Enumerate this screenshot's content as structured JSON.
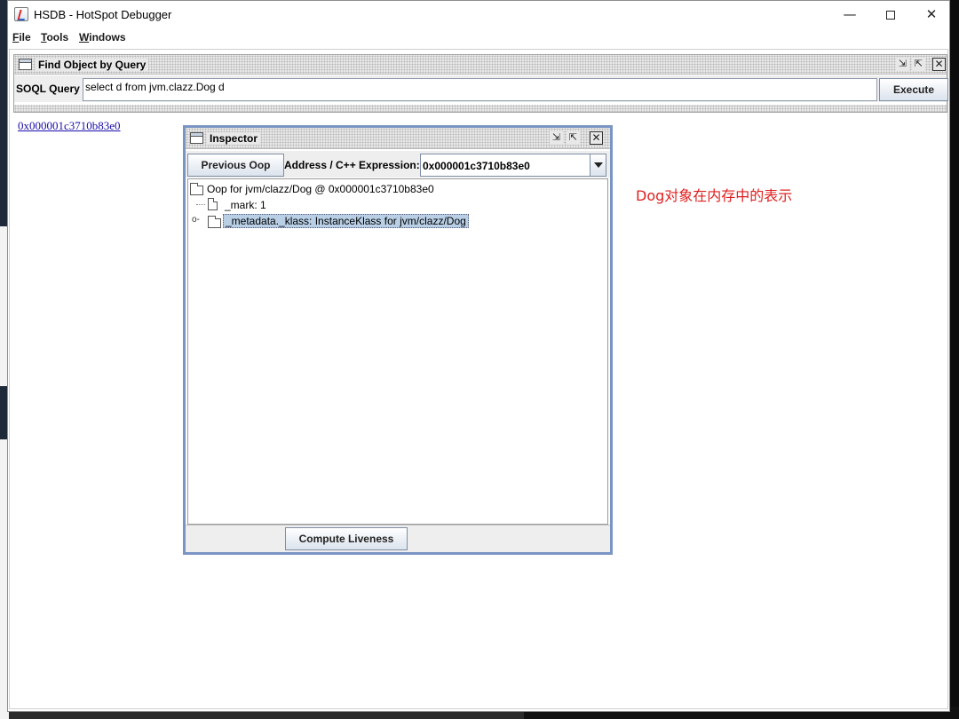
{
  "window": {
    "title": "HSDB - HotSpot Debugger",
    "min_glyph": "—",
    "close_glyph": "✕"
  },
  "menu": {
    "file": {
      "mnemonic": "F",
      "rest": "ile"
    },
    "tools": {
      "mnemonic": "T",
      "rest": "ools"
    },
    "windows": {
      "mnemonic": "W",
      "rest": "indows"
    }
  },
  "query_frame": {
    "title": "Find Object by Query",
    "soql_label": "SOQL Query :",
    "soql_value": "select d from jvm.clazz.Dog d",
    "execute_label": "Execute",
    "iconify_glyph": "⇲",
    "restore_glyph": "⇱",
    "close_glyph": "✕"
  },
  "result_link": "0x000001c3710b83e0",
  "inspector": {
    "title": "Inspector",
    "previous_oop_label": "Previous Oop",
    "address_label": "Address / C++ Expression:",
    "address_value": "0x000001c3710b83e0",
    "tree": {
      "root": "Oop for jvm/clazz/Dog @ 0x000001c3710b83e0",
      "mark": "_mark: 1",
      "klass": "_metadata._klass: InstanceKlass for jvm/clazz/Dog"
    },
    "compute_liveness_label": "Compute Liveness",
    "iconify_glyph": "⇲",
    "maximize_glyph": "⇱",
    "close_glyph": "✕"
  },
  "annotation": "Dog对象在内存中的表示",
  "colors": {
    "annotation": "#e02020",
    "link": "#1a0dab",
    "selection": "#b8cfe5",
    "inspector_border": "#7a95c4"
  }
}
